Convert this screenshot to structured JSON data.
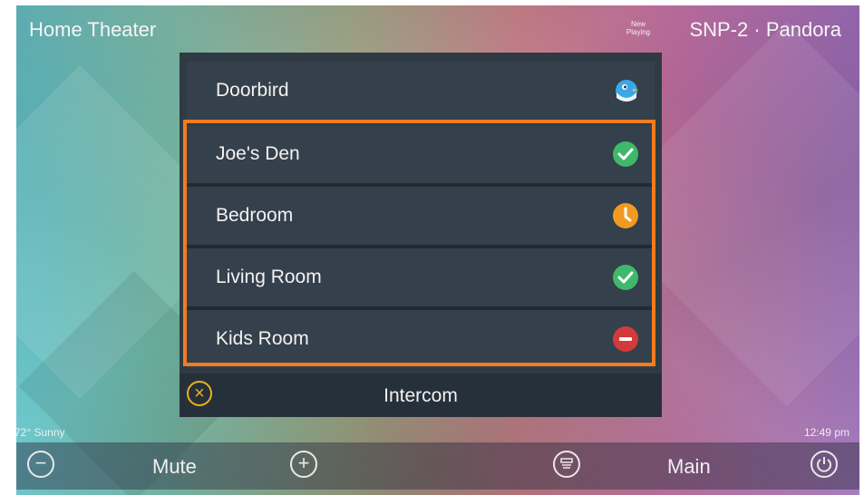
{
  "top_bar": {
    "title": "Home Theater",
    "now_playing_badge": "New Playing",
    "source": "SNP-2 · Pandora"
  },
  "intercom_panel": {
    "rows": [
      {
        "label": "Doorbird",
        "status_icon": "doorbird-bird-icon"
      },
      {
        "label": "Joe's Den",
        "status_icon": "check-circle-icon",
        "status_color": "#3fb86a"
      },
      {
        "label": "Bedroom",
        "status_icon": "clock-icon",
        "status_color": "#f29a1f"
      },
      {
        "label": "Living Room",
        "status_icon": "check-circle-icon",
        "status_color": "#3fb86a"
      },
      {
        "label": "Kids Room",
        "status_icon": "do-not-disturb-icon",
        "status_color": "#d33a3a"
      }
    ],
    "highlight_color": "#f47b20",
    "footer_label": "Intercom",
    "close_icon": "close-circle-icon",
    "close_color": "#e7b21d"
  },
  "status_bar": {
    "weather": "72° Sunny",
    "time": "12:49 pm"
  },
  "bottom_bar": {
    "mute_label": "Mute",
    "main_label": "Main",
    "icons": [
      "volume-down-icon",
      "volume-up-icon",
      "source-icon",
      "power-icon"
    ]
  }
}
